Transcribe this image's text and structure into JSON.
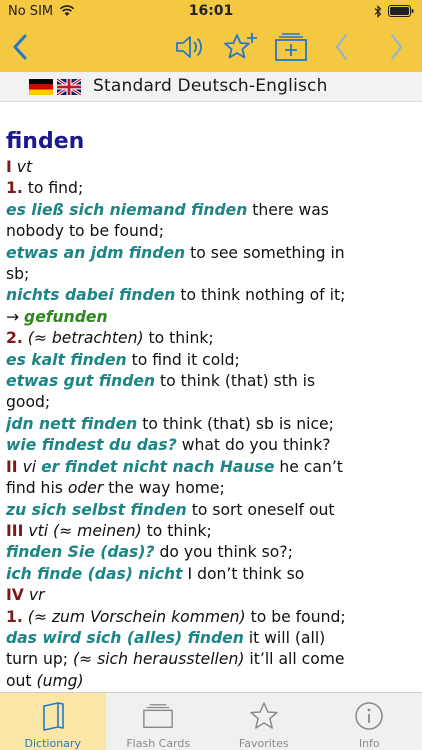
{
  "status": {
    "carrier": "No SIM",
    "time": "16:01"
  },
  "toolbar": {
    "back_icon": "chevron-left-icon",
    "speaker_icon": "speaker-icon",
    "favorite_icon": "star-plus-icon",
    "flashcard_icon": "flashcard-add-icon",
    "prev_icon": "chevron-left-icon",
    "next_icon": "chevron-right-icon"
  },
  "dictionary": {
    "label": "Standard Deutsch-Englisch"
  },
  "entry": {
    "headword": "finden",
    "lines": [
      [
        {
          "t": "I",
          "c": "num"
        },
        {
          "t": " "
        },
        {
          "t": "vt",
          "c": "it"
        }
      ],
      [
        {
          "t": "1.",
          "c": "num"
        },
        {
          "t": " to find;"
        }
      ],
      [
        {
          "t": "es ließ sich niemand finden",
          "c": "ex"
        },
        {
          "t": " there was"
        }
      ],
      [
        {
          "t": "nobody to be found;"
        }
      ],
      [
        {
          "t": "etwas an jdm finden",
          "c": "ex"
        },
        {
          "t": " to see something in"
        }
      ],
      [
        {
          "t": "sb;"
        }
      ],
      [
        {
          "t": "nichts dabei finden",
          "c": "ex"
        },
        {
          "t": " to think nothing of it;"
        }
      ],
      [
        {
          "t": "→ "
        },
        {
          "t": "gefunden",
          "c": "xref"
        }
      ],
      [
        {
          "t": "2.",
          "c": "num"
        },
        {
          "t": " "
        },
        {
          "t": "(≈ betrachten)",
          "c": "it"
        },
        {
          "t": " to think;"
        }
      ],
      [
        {
          "t": "es kalt finden",
          "c": "ex"
        },
        {
          "t": " to find it cold;"
        }
      ],
      [
        {
          "t": "etwas gut finden",
          "c": "ex"
        },
        {
          "t": " to think (that) sth is"
        }
      ],
      [
        {
          "t": "good;"
        }
      ],
      [
        {
          "t": "jdn nett finden",
          "c": "ex"
        },
        {
          "t": " to think (that) sb is nice;"
        }
      ],
      [
        {
          "t": "wie findest du das?",
          "c": "ex"
        },
        {
          "t": " what do you think?"
        }
      ],
      [
        {
          "t": "II",
          "c": "num"
        },
        {
          "t": " "
        },
        {
          "t": "vi",
          "c": "it"
        },
        {
          "t": " "
        },
        {
          "t": "er findet nicht nach Hause",
          "c": "ex"
        },
        {
          "t": " he can’t"
        }
      ],
      [
        {
          "t": "find his "
        },
        {
          "t": "oder",
          "c": "it"
        },
        {
          "t": " the way home;"
        }
      ],
      [
        {
          "t": "zu sich selbst finden",
          "c": "ex"
        },
        {
          "t": " to sort oneself out"
        }
      ],
      [
        {
          "t": "III",
          "c": "num"
        },
        {
          "t": " "
        },
        {
          "t": "vti",
          "c": "it"
        },
        {
          "t": " "
        },
        {
          "t": "(≈ meinen)",
          "c": "it"
        },
        {
          "t": " to think;"
        }
      ],
      [
        {
          "t": "finden Sie (das)?",
          "c": "ex"
        },
        {
          "t": " do you think so?;"
        }
      ],
      [
        {
          "t": "ich finde (das) nicht",
          "c": "ex"
        },
        {
          "t": " I don’t think so"
        }
      ],
      [
        {
          "t": "IV",
          "c": "num"
        },
        {
          "t": " "
        },
        {
          "t": "vr",
          "c": "it"
        }
      ],
      [
        {
          "t": "1.",
          "c": "num"
        },
        {
          "t": " "
        },
        {
          "t": "(≈ zum Vorschein kommen)",
          "c": "it"
        },
        {
          "t": " to be found;"
        }
      ],
      [
        {
          "t": "das wird sich (alles) finden",
          "c": "ex"
        },
        {
          "t": " it will (all)"
        }
      ],
      [
        {
          "t": "turn up; "
        },
        {
          "t": "(≈ sich herausstellen)",
          "c": "it"
        },
        {
          "t": " it’ll all come"
        }
      ],
      [
        {
          "t": "out "
        },
        {
          "t": "(umg)",
          "c": "it"
        }
      ]
    ]
  },
  "tabs": [
    {
      "label": "Dictionary",
      "icon": "dictionary-icon",
      "active": true
    },
    {
      "label": "Flash Cards",
      "icon": "flashcards-icon",
      "active": false
    },
    {
      "label": "Favorites",
      "icon": "star-icon",
      "active": false
    },
    {
      "label": "Info",
      "icon": "info-icon",
      "active": false
    }
  ],
  "colors": {
    "bar": "#f5c842",
    "headword": "#1a1a8c",
    "sense_number": "#7a1a1a",
    "example": "#1d8585",
    "cross_reference": "#2c8a1c",
    "active_tab": "#2478c8"
  }
}
